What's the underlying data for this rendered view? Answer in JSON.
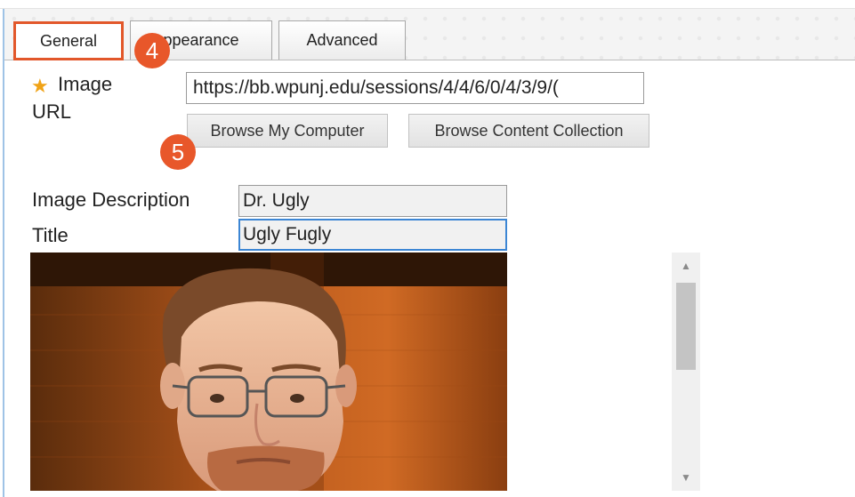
{
  "tabs": [
    {
      "label": "General",
      "active": true
    },
    {
      "label": "ppearance",
      "active": false
    },
    {
      "label": "Advanced",
      "active": false
    }
  ],
  "step_badges": [
    "4",
    "5"
  ],
  "form": {
    "required_marker": "★",
    "image_url_label_line1": "Image",
    "image_url_label_line2": "URL",
    "image_url_value": "https://bb.wpunj.edu/sessions/4/4/6/0/4/3/9/(",
    "browse_computer_label": "Browse My Computer",
    "browse_collection_label": "Browse Content Collection",
    "image_description_label": "Image Description",
    "image_description_value": "Dr. Ugly",
    "title_label": "Title",
    "title_value": "Ugly Fugly"
  },
  "preview": {
    "alt": "Image preview of a bearded man wearing glasses"
  },
  "scrollbar": {
    "up_icon": "▲",
    "down_icon": "▼"
  },
  "colors": {
    "accent_orange": "#e8572a",
    "required_star": "#f0a317",
    "focus_border": "#3c86d4"
  }
}
